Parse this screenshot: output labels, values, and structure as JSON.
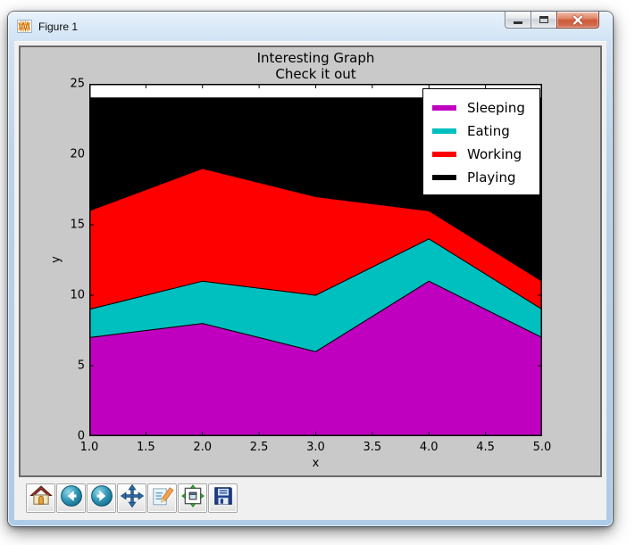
{
  "window": {
    "title": "Figure 1"
  },
  "toolbar": {
    "buttons": [
      {
        "name": "home",
        "icon": "home-icon"
      },
      {
        "name": "back",
        "icon": "back-icon"
      },
      {
        "name": "forward",
        "icon": "forward-icon"
      },
      {
        "name": "pan",
        "icon": "pan-icon"
      },
      {
        "name": "zoom-to-rect",
        "icon": "zoom-to-rect-icon"
      },
      {
        "name": "configure-subplots",
        "icon": "configure-subplots-icon"
      },
      {
        "name": "save",
        "icon": "save-icon"
      }
    ]
  },
  "chart_data": {
    "type": "area",
    "stacked": true,
    "title": "Interesting Graph",
    "subtitle": "Check it out",
    "xlabel": "x",
    "ylabel": "y",
    "x": [
      1,
      2,
      3,
      4,
      5
    ],
    "series": [
      {
        "name": "Sleeping",
        "color": "#bf00bf",
        "values": [
          7,
          8,
          6,
          11,
          7
        ]
      },
      {
        "name": "Eating",
        "color": "#00bfbf",
        "values": [
          2,
          3,
          4,
          3,
          2
        ]
      },
      {
        "name": "Working",
        "color": "#ff0000",
        "values": [
          7,
          8,
          7,
          2,
          2
        ]
      },
      {
        "name": "Playing",
        "color": "#000000",
        "values": [
          8,
          5,
          7,
          8,
          13
        ]
      }
    ],
    "stack_totals": [
      24,
      24,
      24,
      24,
      24
    ],
    "xlim": [
      1,
      5
    ],
    "ylim": [
      0,
      25
    ],
    "xticks": [
      "1.0",
      "1.5",
      "2.0",
      "2.5",
      "3.0",
      "3.5",
      "4.0",
      "4.5",
      "5.0"
    ],
    "yticks": [
      "0",
      "5",
      "10",
      "15",
      "20",
      "25"
    ],
    "legend_position": "upper right",
    "grid": false,
    "figure_bg": "#c9c9c9",
    "axes_bg": "#ffffff"
  }
}
